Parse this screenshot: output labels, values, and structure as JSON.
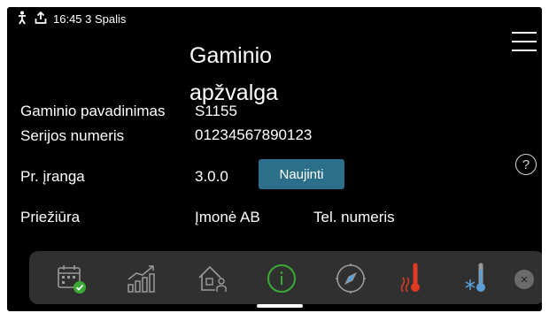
{
  "statusbar": {
    "time_label": "16:45 3 Spalis",
    "icons": [
      "person-icon",
      "upload-icon"
    ]
  },
  "page": {
    "title_line1": "Gaminio",
    "title_line2": "apžvalga"
  },
  "info": {
    "product_name_label": "Gaminio pavadinimas",
    "product_name_value": "S1155",
    "serial_label": "Serijos numeris",
    "serial_value": "01234567890123",
    "firmware_label": "Pr. įranga",
    "firmware_value": "3.0.0",
    "update_button": "Naujinti",
    "service_label": "Priežiūra",
    "company_value": "Įmonė AB",
    "phone_value": "Tel. numeris"
  },
  "help_symbol": "?",
  "nav": {
    "items": [
      "calendar-check-icon",
      "statistics-icon",
      "house-person-icon",
      "info-icon",
      "compass-icon",
      "heating-thermometer-icon",
      "cooling-thermometer-icon"
    ],
    "close_symbol": "×"
  },
  "colors": {
    "accent_green": "#3aaa35",
    "heating_red": "#e03a22",
    "cooling_blue": "#5a9fd8",
    "update_button_bg": "#2b6f8a",
    "navbar_bg": "#303030"
  }
}
